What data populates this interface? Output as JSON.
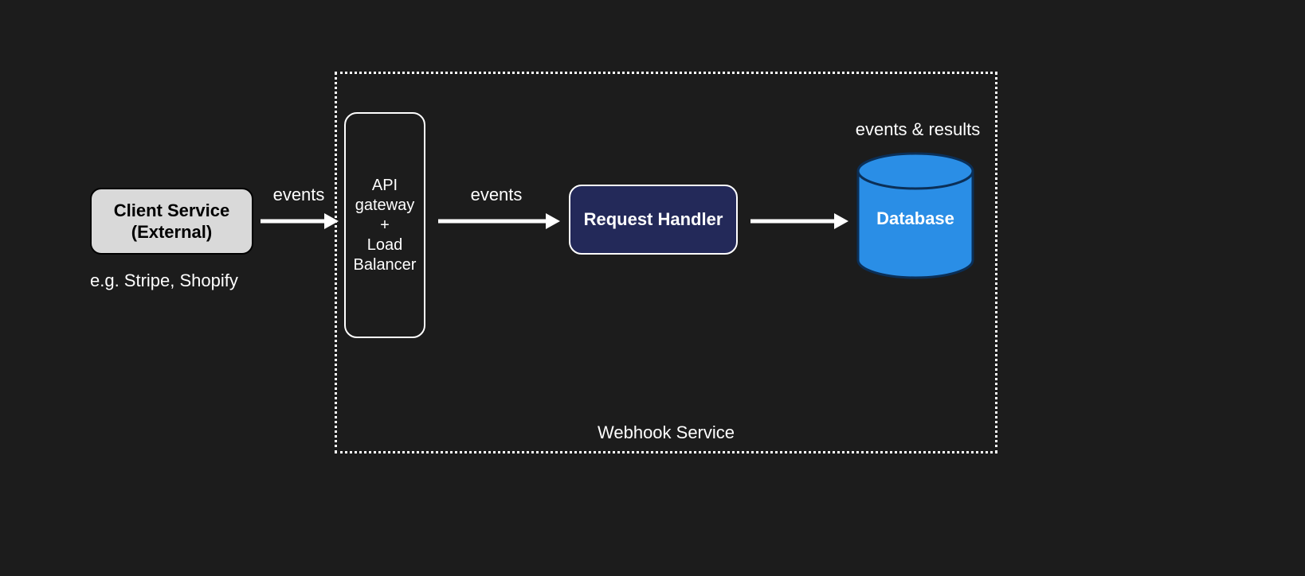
{
  "container": {
    "title": "Webhook Service"
  },
  "client": {
    "title": "Client Service\n(External)",
    "sub": "e.g. Stripe, Shopify"
  },
  "gateway": {
    "title": "API gateway\n+\nLoad Balancer"
  },
  "request_handler": {
    "title": "Request Handler"
  },
  "database": {
    "title": "Database",
    "caption": "events & results"
  },
  "arrows": {
    "a1": "events",
    "a2": "events",
    "a3": ""
  },
  "colors": {
    "background": "#1c1c1c",
    "client_fill": "#d9d9d9",
    "request_fill": "#232959",
    "db_fill": "#2a8ee6",
    "db_stroke": "#0b2f57",
    "line": "#ffffff"
  }
}
